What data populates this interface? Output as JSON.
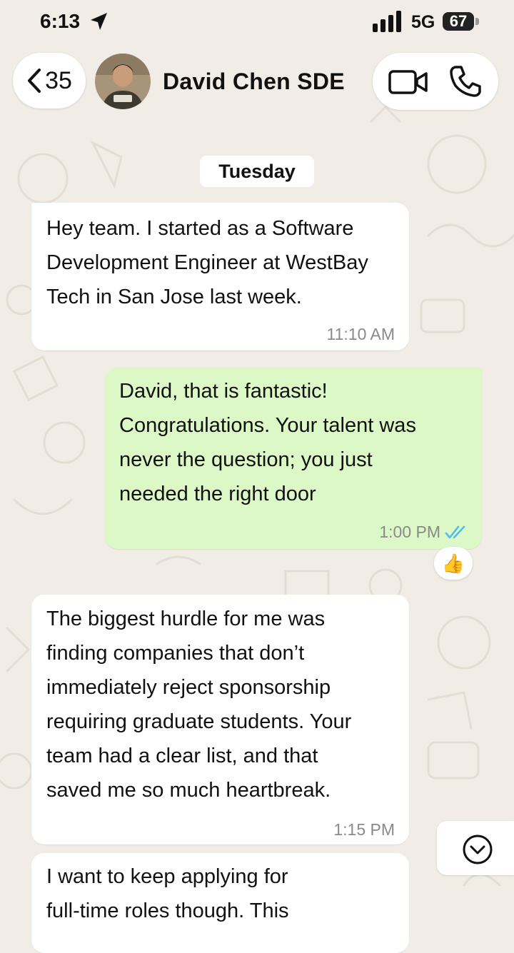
{
  "status_bar": {
    "time": "6:13",
    "network": "5G",
    "battery": "67",
    "icons": [
      "location-arrow-icon",
      "signal-bars-icon"
    ]
  },
  "header": {
    "back_count": "35",
    "contact_name": "David Chen SDE",
    "icons": [
      "chevron-left-icon",
      "video-call-icon",
      "phone-call-icon"
    ]
  },
  "date_divider": "Tuesday",
  "messages": [
    {
      "direction": "incoming",
      "lines": [
        "Hey team. I started as a Software",
        "Development Engineer at WestBay",
        "Tech in San Jose last week."
      ],
      "time": "11:10 AM"
    },
    {
      "direction": "outgoing",
      "lines": [
        "David, that is fantastic!",
        "Congratulations. Your talent was",
        "never the question; you just",
        "needed the right door"
      ],
      "time": "1:00 PM",
      "status": "read",
      "reaction": "👍"
    },
    {
      "direction": "incoming",
      "lines": [
        "The biggest hurdle for me was",
        "finding companies that don’t",
        "immediately reject sponsorship",
        "requiring graduate students. Your",
        "team had a clear list, and that",
        "saved me so much heartbreak."
      ],
      "time": "1:15 PM"
    },
    {
      "direction": "incoming",
      "lines": [
        "I want to keep applying for",
        "full-time roles though. This"
      ],
      "time": ""
    }
  ],
  "colors": {
    "background": "#f1ede6",
    "incoming_bubble": "#ffffff",
    "outgoing_bubble": "#dcf8c6",
    "read_check": "#53bdeb",
    "timestamp": "#8a8a8a"
  }
}
